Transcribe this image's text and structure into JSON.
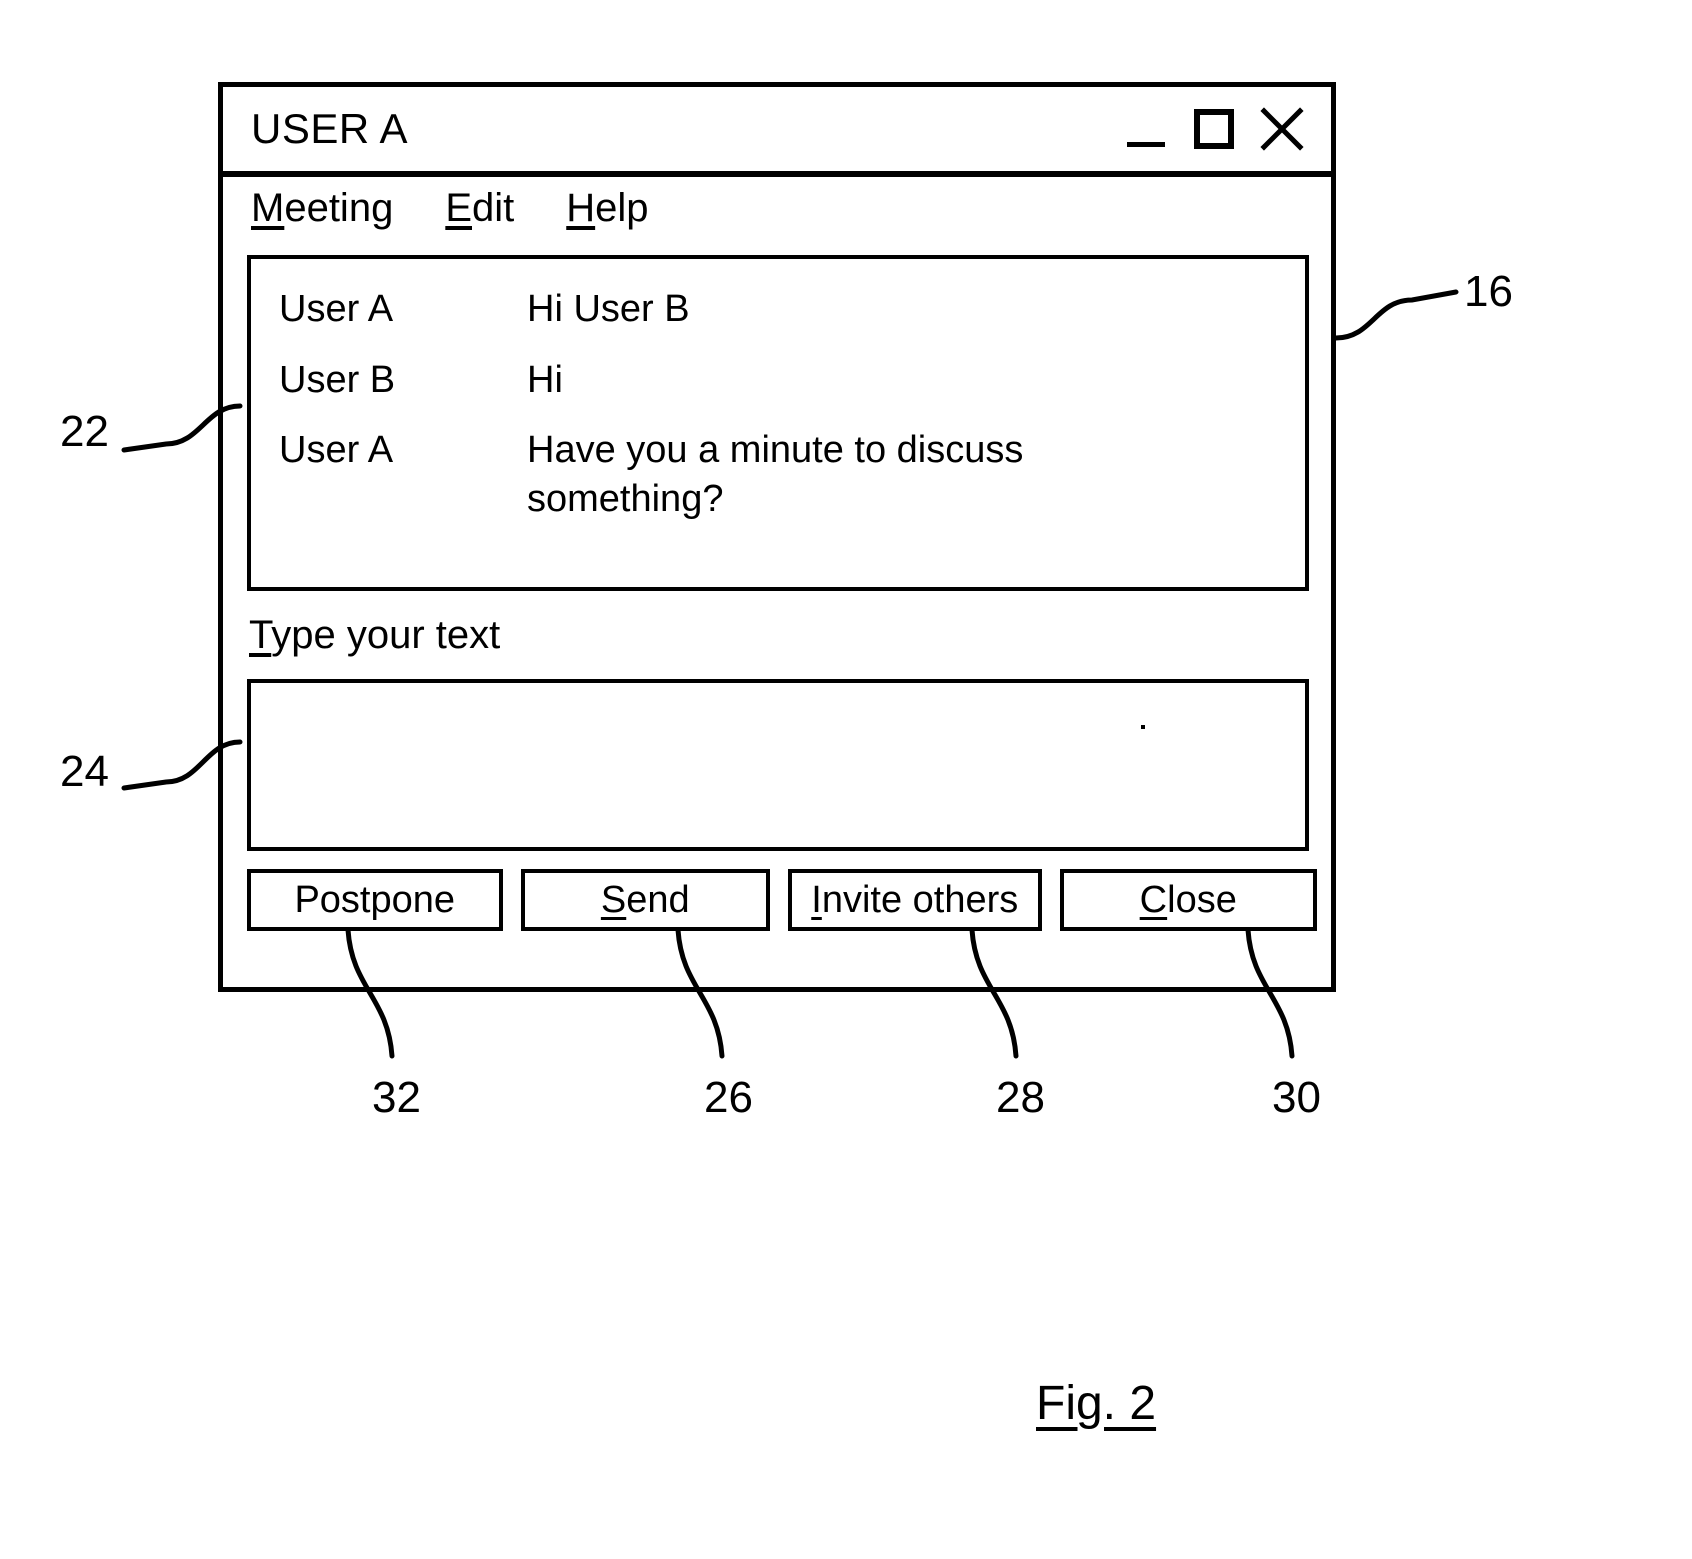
{
  "window": {
    "title": "USER A",
    "controls": [
      {
        "name": "minimize-icon",
        "glyph": "minimize"
      },
      {
        "name": "maximize-icon",
        "glyph": "maximize"
      },
      {
        "name": "close-icon",
        "glyph": "close"
      }
    ]
  },
  "menu": {
    "items": [
      {
        "accel": "M",
        "rest": "eeting",
        "label": "Meeting"
      },
      {
        "accel": "E",
        "rest": "dit",
        "label": "Edit"
      },
      {
        "accel": "H",
        "rest": "elp",
        "label": "Help"
      }
    ]
  },
  "messages": {
    "rows": [
      {
        "author": "User A",
        "text": "Hi User B"
      },
      {
        "author": "User B",
        "text": "Hi"
      },
      {
        "author": "User A",
        "text": "Have you a minute to discuss something?"
      }
    ]
  },
  "compose": {
    "label_accel": "T",
    "label_rest": "ype your text",
    "label": "Type your text",
    "value": "",
    "placeholder": ""
  },
  "buttons": [
    {
      "accel": "",
      "rest": "Postpone",
      "label": "Postpone"
    },
    {
      "accel": "S",
      "rest": "end",
      "label": "Send"
    },
    {
      "accel": "I",
      "rest": "nvite others",
      "label": "Invite others"
    },
    {
      "accel": "C",
      "rest": "lose",
      "label": "Close"
    }
  ],
  "references": {
    "window_frame": "16",
    "messages_panel": "22",
    "compose_input": "24",
    "postpone_button": "32",
    "send_button": "26",
    "invite_button": "28",
    "close_button": "30"
  },
  "caption": "Fig. 2",
  "colors": {
    "ink": "#000000",
    "paper": "#ffffff"
  }
}
